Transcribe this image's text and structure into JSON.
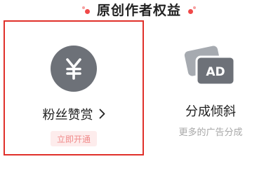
{
  "header": {
    "title": "原创作者权益"
  },
  "benefits": [
    {
      "label": "粉丝赞赏",
      "icon": "yen-coin-icon",
      "badge": "立即开通",
      "selected": true
    },
    {
      "label": "分成倾斜",
      "icon": "ad-cards-icon",
      "ad_text": "AD",
      "subtitle": "更多的广告分成",
      "selected": false
    }
  ],
  "colors": {
    "accent": "#e0302a",
    "icon_gray": "#6d7178",
    "badge_bg": "#fdecec",
    "badge_text": "#f08a8a",
    "subtitle": "#a8a8a8"
  }
}
